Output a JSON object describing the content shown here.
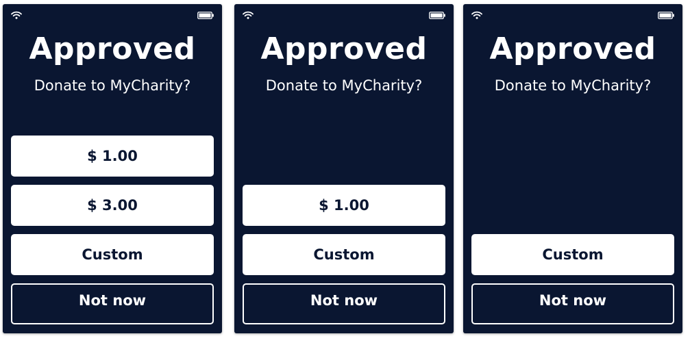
{
  "colors": {
    "screen_background": "#0a1631",
    "button_fill": "#ffffff",
    "button_text": "#0a1631",
    "text_light": "#ffffff"
  },
  "icons": {
    "wifi": "wifi-icon",
    "battery": "battery-icon"
  },
  "screens": [
    {
      "title": "Approved",
      "subtitle": "Donate to MyCharity?",
      "amounts": [
        "$ 1.00",
        "$ 3.00"
      ],
      "custom_label": "Custom",
      "decline_label": "Not now"
    },
    {
      "title": "Approved",
      "subtitle": "Donate to MyCharity?",
      "amounts": [
        "$ 1.00"
      ],
      "custom_label": "Custom",
      "decline_label": "Not now"
    },
    {
      "title": "Approved",
      "subtitle": "Donate to MyCharity?",
      "amounts": [],
      "custom_label": "Custom",
      "decline_label": "Not now"
    }
  ]
}
